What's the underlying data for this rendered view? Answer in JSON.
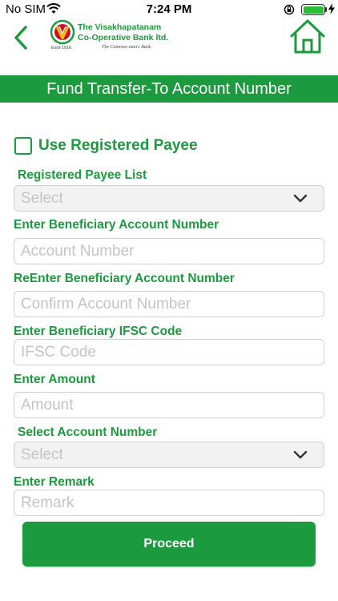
{
  "status_bar": {
    "carrier": "No SIM",
    "time": "7:24 PM",
    "icons": [
      "wifi-icon",
      "orientation-lock-icon",
      "battery-icon",
      "charging-icon"
    ]
  },
  "header": {
    "logo": {
      "name_line1": "The Visakhapatanam",
      "name_line2": "Co-Operative Bank ltd.",
      "estd": "Estd-1916",
      "tagline": "The Common man's Bank"
    },
    "back_icon": "chevron-left-icon",
    "home_icon": "home-icon"
  },
  "title": "Fund Transfer-To Account Number",
  "form": {
    "use_registered_payee_label": "Use Registered Payee",
    "registered_payee": {
      "label": "Registered Payee List",
      "selected": "Select"
    },
    "account_number": {
      "label": "Enter Beneficiary Account Number",
      "placeholder": "Account Number",
      "value": ""
    },
    "confirm_account_number": {
      "label": "ReEnter Beneficiary Account Number",
      "placeholder": "Confirm Account Number",
      "value": ""
    },
    "ifsc": {
      "label": "Enter Beneficiary IFSC Code",
      "placeholder": "IFSC Code",
      "value": ""
    },
    "amount": {
      "label": "Enter Amount",
      "placeholder": "Amount",
      "value": ""
    },
    "select_account": {
      "label": "Select Account Number",
      "selected": "Select"
    },
    "remark": {
      "label": "Enter Remark",
      "placeholder": "Remark",
      "value": ""
    },
    "proceed_label": "Proceed"
  },
  "colors": {
    "brand_green": "#1c9a3e",
    "input_border": "#d0d0d0",
    "placeholder": "#c4c4c4"
  }
}
